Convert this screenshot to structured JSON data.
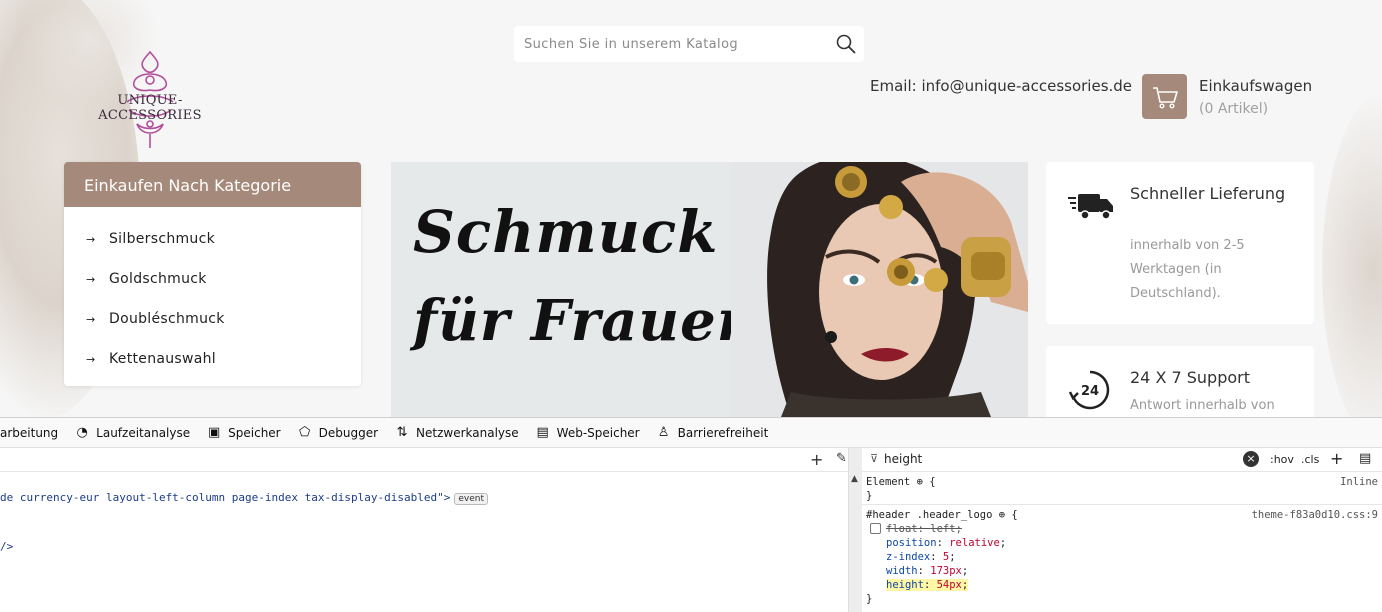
{
  "site": {
    "logo_text": "UNIQUE-ACCESSORIES",
    "search": {
      "placeholder": "Suchen Sie in unserem Katalog",
      "icon": "search-icon"
    },
    "email": "Email: info@unique-accessories.de",
    "cart": {
      "title": "Einkaufswagen",
      "count": "(0 Artikel)",
      "icon": "cart-icon"
    },
    "categories": {
      "title": "Einkaufen Nach Kategorie",
      "items": [
        {
          "label": "Silberschmuck"
        },
        {
          "label": "Goldschmuck"
        },
        {
          "label": "Doubléschmuck"
        },
        {
          "label": "Kettenauswahl"
        }
      ]
    },
    "banner": {
      "line1": "Schmuck",
      "line2": "für Frauen"
    },
    "features": [
      {
        "icon": "delivery-truck-icon",
        "title": "Schneller Lieferung",
        "text": "innerhalb von 2-5 Werktagen (in Deutschland)."
      },
      {
        "icon": "support-24-icon",
        "title": "24 X 7 Support",
        "text": "Antwort innerhalb von"
      }
    ],
    "accent_color": "#a5897a"
  },
  "devtools": {
    "tabs": [
      {
        "label": "arbeitung",
        "icon": ""
      },
      {
        "label": "Laufzeitanalyse",
        "icon": "gauge-icon"
      },
      {
        "label": "Speicher",
        "icon": "chip-icon"
      },
      {
        "label": "Debugger",
        "icon": "debugger-icon"
      },
      {
        "label": "Netzwerkanalyse",
        "icon": "network-arrows-icon"
      },
      {
        "label": "Web-Speicher",
        "icon": "storage-icon"
      },
      {
        "label": "Barrierefreiheit",
        "icon": "accessibility-icon"
      }
    ],
    "markup": {
      "line1": "de currency-eur layout-left-column page-index tax-display-disabled\">",
      "event_badge": "event",
      "line2": "/>"
    },
    "rules_panel": {
      "filter_value": "height",
      "hov": ":hov",
      "cls": ".cls",
      "element_rule": "Element",
      "element_source": "Inline",
      "selector": "#header .header_logo",
      "source": "theme-f83a0d10.css:9",
      "declarations": [
        {
          "prop": "float",
          "value": "left",
          "disabled": true
        },
        {
          "prop": "position",
          "value": "relative"
        },
        {
          "prop": "z-index",
          "value": "5"
        },
        {
          "prop": "width",
          "value": "173px"
        },
        {
          "prop": "height",
          "value": "54px",
          "highlighted": true
        }
      ]
    }
  }
}
